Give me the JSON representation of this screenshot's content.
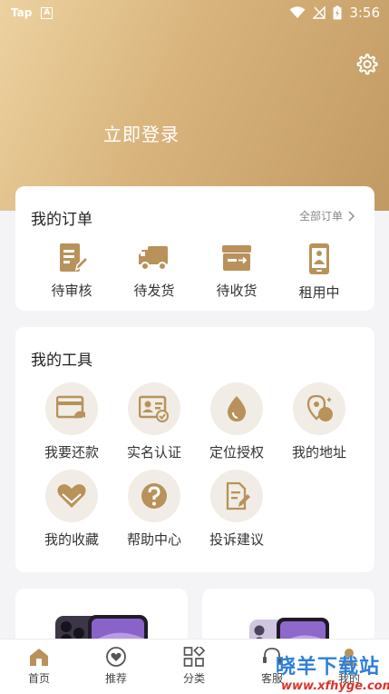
{
  "status_bar": {
    "left_app": "Tap",
    "left_badge": "A",
    "time": "3:56"
  },
  "header": {
    "login_label": "立即登录",
    "settings_icon": "gear-icon"
  },
  "orders": {
    "title": "我的订单",
    "view_all": "全部订单",
    "items": [
      {
        "label": "待审核",
        "icon": "review-doc-icon"
      },
      {
        "label": "待发货",
        "icon": "truck-icon"
      },
      {
        "label": "待收货",
        "icon": "package-box-icon"
      },
      {
        "label": "租用中",
        "icon": "phone-rent-icon"
      }
    ]
  },
  "tools": {
    "title": "我的工具",
    "items": [
      {
        "label": "我要还款",
        "icon": "repay-card-icon"
      },
      {
        "label": "实名认证",
        "icon": "id-card-icon"
      },
      {
        "label": "定位授权",
        "icon": "location-drop-icon"
      },
      {
        "label": "我的地址",
        "icon": "address-pin-icon"
      },
      {
        "label": "我的收藏",
        "icon": "heart-icon"
      },
      {
        "label": "帮助中心",
        "icon": "help-icon"
      },
      {
        "label": "投诉建议",
        "icon": "complaint-doc-icon"
      }
    ]
  },
  "tabbar": {
    "items": [
      {
        "label": "首页",
        "icon": "home-icon"
      },
      {
        "label": "推荐",
        "icon": "recommend-heart-icon"
      },
      {
        "label": "分类",
        "icon": "category-grid-icon"
      },
      {
        "label": "客服",
        "icon": "service-icon"
      },
      {
        "label": "我的",
        "icon": "profile-icon"
      }
    ]
  },
  "watermark": {
    "name": "晓羊下载站",
    "url": "www.xfhyge.com"
  },
  "colors": {
    "accent": "#b8925a",
    "header_start": "#ecd2a0",
    "header_end": "#c09a62",
    "background": "#f4f4f6"
  }
}
